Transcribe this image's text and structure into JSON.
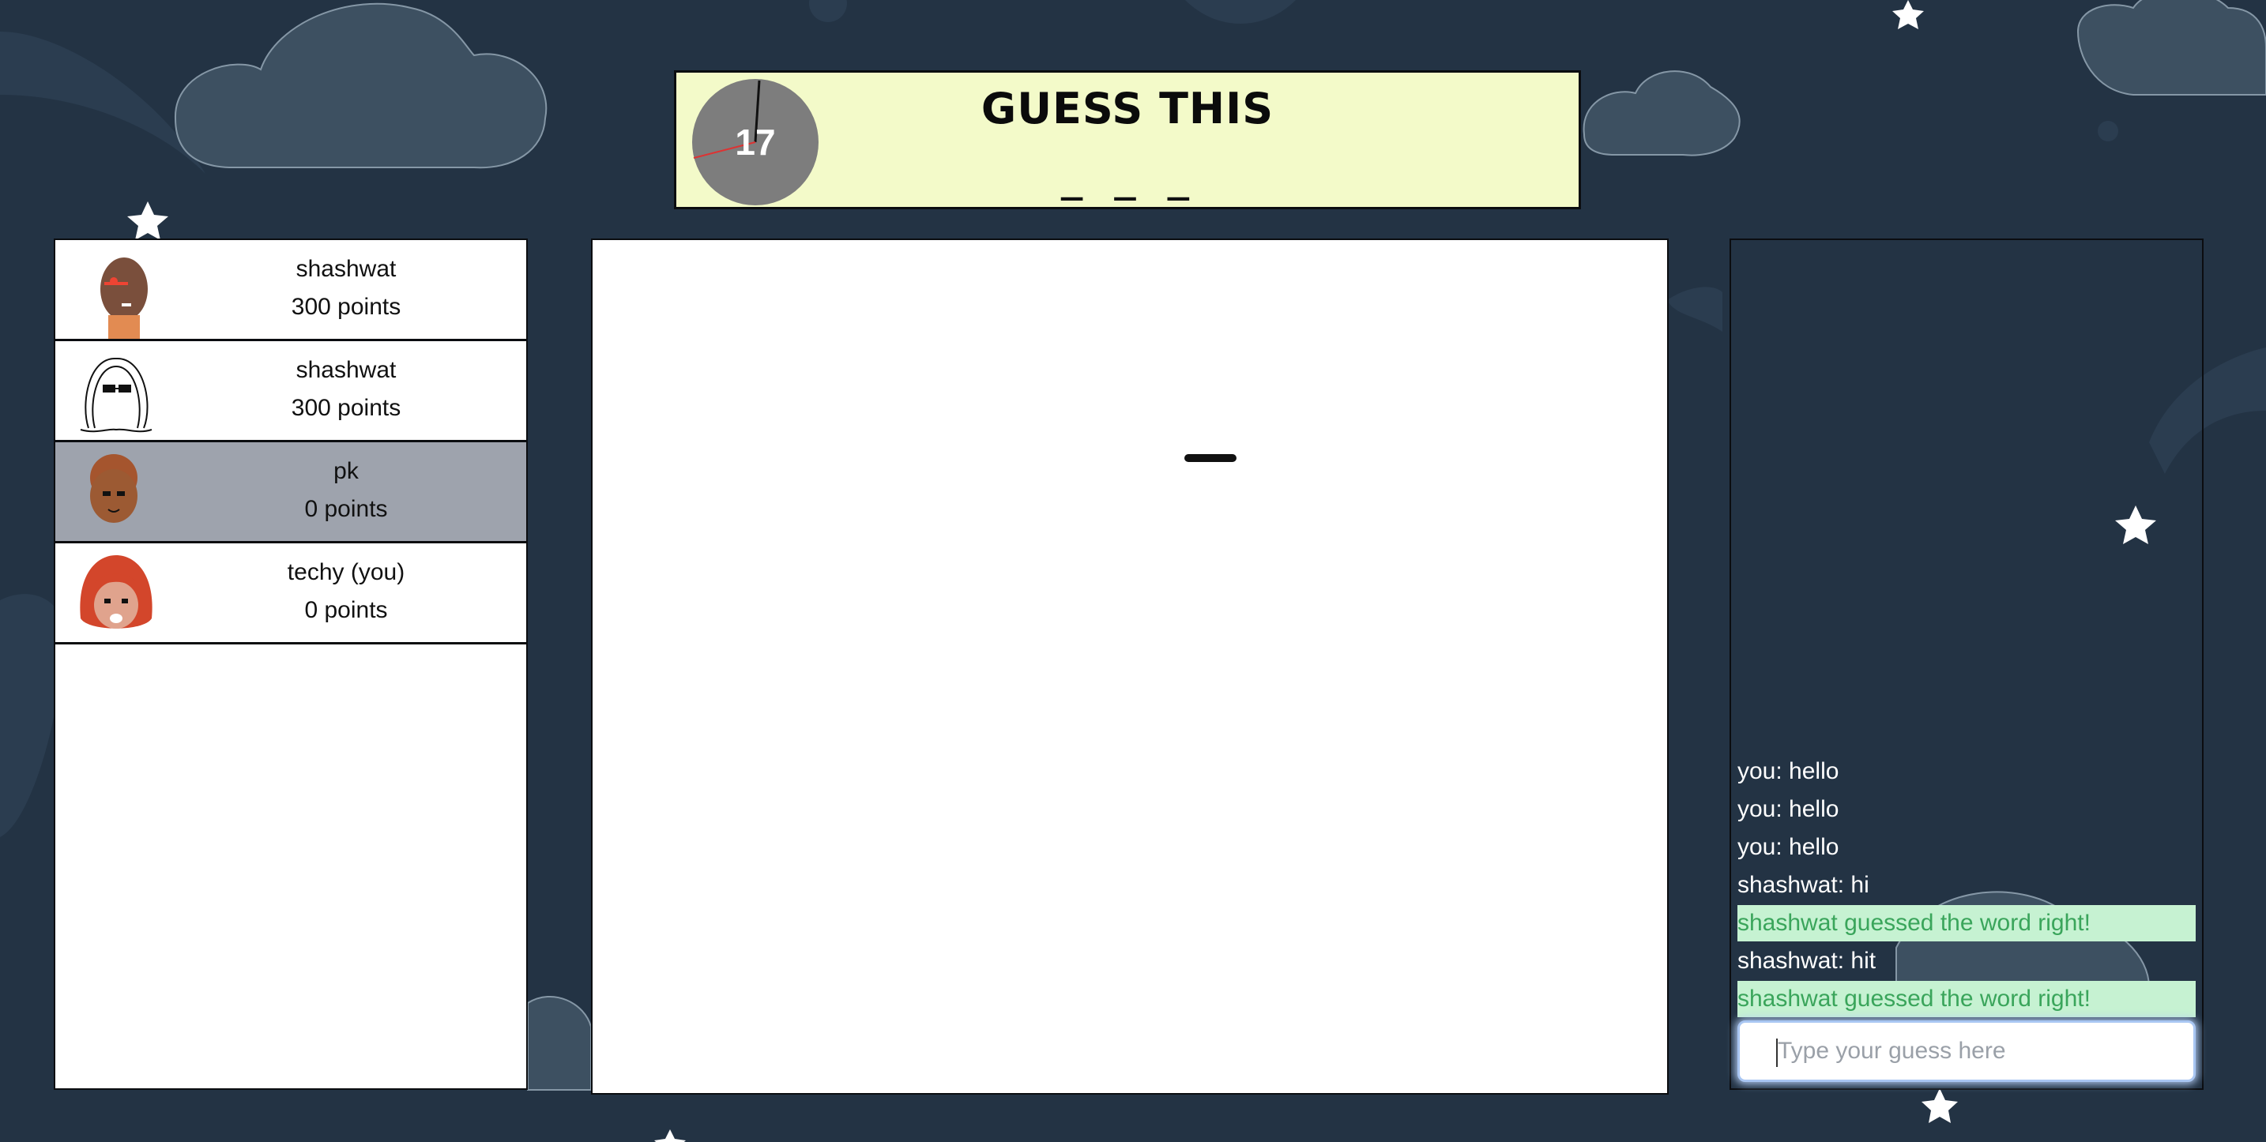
{
  "header": {
    "timer_value": "17",
    "title": "GUESS THIS",
    "word_blanks": "_ _ _"
  },
  "players": [
    {
      "name": "shashwat",
      "points": "300 points",
      "avatar": "bald-avatar",
      "active": false
    },
    {
      "name": "shashwat",
      "points": "300 points",
      "avatar": "long-hair-sunglasses-avatar",
      "active": false
    },
    {
      "name": "pk",
      "points": "0 points",
      "avatar": "curly-hair-avatar",
      "active": true
    },
    {
      "name": "techy (you)",
      "points": "0 points",
      "avatar": "red-hair-avatar",
      "active": false
    }
  ],
  "chat": {
    "messages": [
      {
        "text": "you: hello",
        "type": "user"
      },
      {
        "text": "you: hello",
        "type": "user"
      },
      {
        "text": "you: hello",
        "type": "user"
      },
      {
        "text": "shashwat: hi",
        "type": "user"
      },
      {
        "text": "shashwat guessed the word right!",
        "type": "system"
      },
      {
        "text": "shashwat: hit",
        "type": "user"
      },
      {
        "text": "shashwat guessed the word right!",
        "type": "system"
      }
    ],
    "input_placeholder": "Type your guess here",
    "input_value": ""
  },
  "colors": {
    "background": "#233344",
    "header_bg": "#f3fac9",
    "active_player_bg": "#9ea3ad",
    "system_message_bg": "#c6f2d2",
    "system_message_text": "#3aa55b"
  }
}
